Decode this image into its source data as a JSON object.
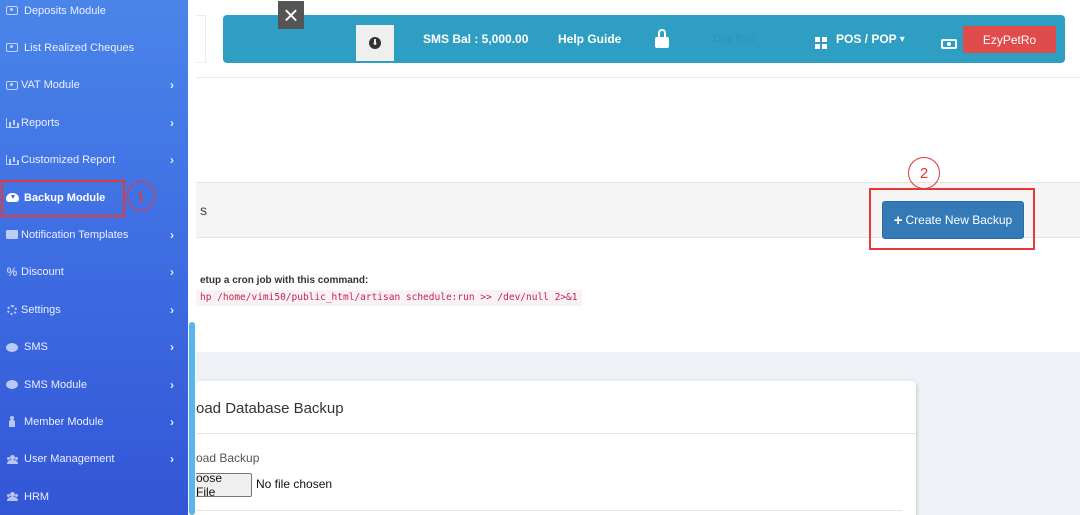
{
  "topbar": {
    "sms_balance": "SMS Bal : 5,000.00",
    "help_guide": "Help Guide",
    "day_end": "Day End",
    "pos_menu": "POS / POP",
    "user_name": "EzyPetRo",
    "close_symbol": "×",
    "download_symbol": "⬇",
    "caret_symbol": "▾"
  },
  "sidebar": {
    "arrow_symbol": "›",
    "items": [
      {
        "label": "Deposits Module",
        "icon": "money-card-icon",
        "has_arrow": false
      },
      {
        "label": "List Realized Cheques",
        "icon": "money-card-icon",
        "has_arrow": false
      },
      {
        "label": "VAT Module",
        "icon": "card-icon",
        "has_arrow": true
      },
      {
        "label": "Reports",
        "icon": "bar-chart-icon",
        "has_arrow": true
      },
      {
        "label": "Customized Report",
        "icon": "bar-chart-icon",
        "has_arrow": true
      },
      {
        "label": "Backup Module",
        "icon": "cloud-download-icon",
        "has_arrow": false,
        "active": true
      },
      {
        "label": "Notification Templates",
        "icon": "envelope-icon",
        "has_arrow": true
      },
      {
        "label": "Discount",
        "icon": "percent-icon",
        "has_arrow": true
      },
      {
        "label": "Settings",
        "icon": "cogs-icon",
        "has_arrow": true
      },
      {
        "label": "SMS",
        "icon": "comments-icon",
        "has_arrow": true
      },
      {
        "label": "SMS Module",
        "icon": "comments-icon",
        "has_arrow": true
      },
      {
        "label": "Member Module",
        "icon": "person-icon",
        "has_arrow": true
      },
      {
        "label": "User Management",
        "icon": "users-icon",
        "has_arrow": true
      },
      {
        "label": "HRM",
        "icon": "users-icon",
        "has_arrow": false
      }
    ]
  },
  "backups": {
    "title_fragment": "s",
    "create_button": "Create New Backup",
    "create_button_icon": "+",
    "cron_label": "etup a cron job with this command:",
    "cron_command": "hp /home/vimi50/public_html/artisan schedule:run >> /dev/null 2>&1"
  },
  "upload_card": {
    "title": "oad Database Backup",
    "field_label": "oad Backup",
    "choose_button": "oose File",
    "file_status": "No file chosen"
  },
  "annotations": {
    "step1": "1",
    "step2": "2"
  },
  "colors": {
    "topbar": "#2e9ec3",
    "sidebar_top": "#4a85e9",
    "sidebar_bottom": "#3356d6",
    "primary_button": "#337ab7",
    "user_button": "#e04b4b",
    "annotation": "#e53935"
  }
}
